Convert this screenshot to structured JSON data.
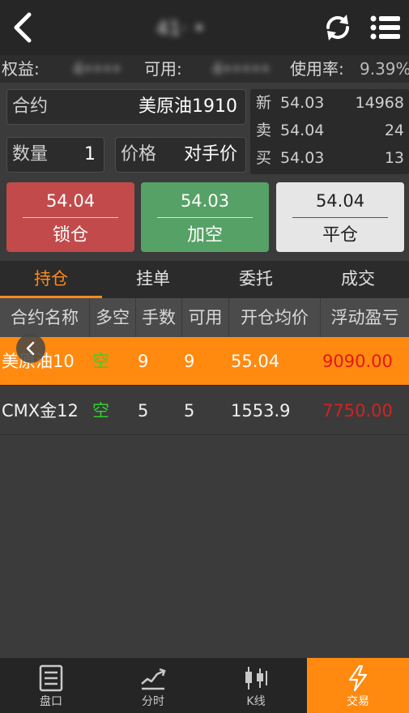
{
  "header": {
    "title": "41· •"
  },
  "account": {
    "equity_label": "权益:",
    "equity_value": "4••••",
    "available_label": "可用:",
    "available_value": "4•••••",
    "usage_label": "使用率:",
    "usage_value": "9.39%"
  },
  "order": {
    "contract_label": "合约",
    "contract_value": "美原油1910",
    "quantity_label": "数量",
    "quantity_value": "1",
    "price_label": "价格",
    "price_value": "对手价"
  },
  "quote": {
    "rows": [
      {
        "label": "新",
        "price": "54.03",
        "volume": "14968"
      },
      {
        "label": "卖",
        "price": "54.04",
        "volume": "24"
      },
      {
        "label": "买",
        "price": "54.03",
        "volume": "13"
      }
    ]
  },
  "actions": {
    "lock": {
      "price": "54.04",
      "label": "锁仓"
    },
    "short": {
      "price": "54.03",
      "label": "加空"
    },
    "close": {
      "price": "54.04",
      "label": "平仓"
    }
  },
  "tabs": [
    "持仓",
    "挂单",
    "委托",
    "成交"
  ],
  "table": {
    "headers": [
      "合约名称",
      "多空",
      "手数",
      "可用",
      "开仓均价",
      "浮动盈亏"
    ],
    "rows": [
      {
        "name": "美原油10",
        "side": "空",
        "lots": "9",
        "available": "9",
        "avg_price": "55.04",
        "pnl": "9090.00"
      },
      {
        "name": "CMX金12",
        "side": "空",
        "lots": "5",
        "available": "5",
        "avg_price": "1553.9",
        "pnl": "7750.00"
      }
    ]
  },
  "bottom_nav": [
    {
      "label": "盘口",
      "icon": "orderbook-icon"
    },
    {
      "label": "分时",
      "icon": "timeshare-chart-icon"
    },
    {
      "label": "K线",
      "icon": "candlestick-icon"
    },
    {
      "label": "交易",
      "icon": "lightning-icon"
    }
  ],
  "colors": {
    "accent": "#ff8a0f",
    "lock_button": "#c24a4a",
    "short_button": "#56a165",
    "close_button": "#e6e6e6",
    "pnl_red": "#e01818",
    "short_green": "#2fd32f"
  }
}
